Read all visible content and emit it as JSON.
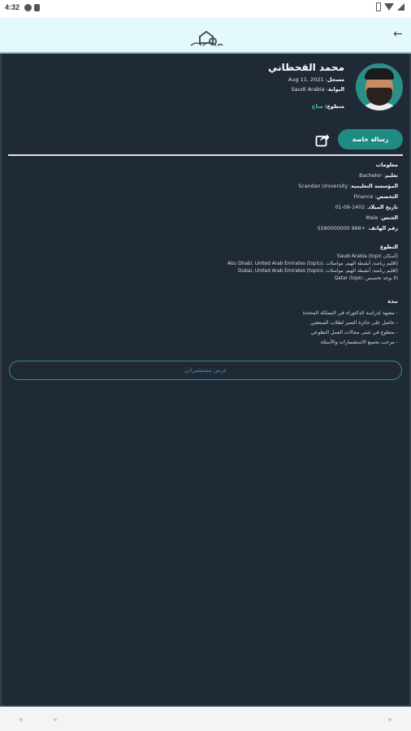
{
  "status_bar": {
    "time": "4:32"
  },
  "app_bar": {
    "back_icon": "arrow-left-icon",
    "logo_icon": "mosque-logo-icon"
  },
  "profile": {
    "name": "محمد القحطاني",
    "registered_label": "مسجل",
    "registered_date": "Aug 11, 2021",
    "country_label": "البوابة",
    "country": "Saudi Arabia",
    "status_label": "متطوع",
    "status": "متاح",
    "status_color": "#3fd69d"
  },
  "actions": {
    "message_button": "رسالة خاصة",
    "share_icon": "share-icon",
    "accent": "#208b84"
  },
  "info": {
    "section_title": "معلومات",
    "education_label": "تعليم",
    "education": "Bachelor",
    "institution_label": "المؤسسة التعليمية",
    "institution": "Scandan University",
    "specialty_label": "التخصص",
    "specialty": "Finance",
    "birth_label": "تاريخ الميلاد",
    "birth": "1402-09-01",
    "gender_label": "الجنس",
    "gender": "Male",
    "phone_label": "رقم الهاتف",
    "phone": "+966 5580000000"
  },
  "tours": {
    "section_title": "التطوع",
    "rows": [
      "(أسكان Saudi Arabia (topic",
      "(اقليم رياضة, أنشطة الهيم, مواصلات :Abu Dhabi, United Arab Emirates (topics",
      "(اقليم رياضة, أنشطة الهيم, مواصلات :Dubai, United Arab Emirates (topics",
      "(لا يوجد تخصيص :Qatar (topic"
    ]
  },
  "about": {
    "section_title": "نبذة",
    "rows": [
      "- مشهد لدراسة الدكتوراه في المملكة المتحدة",
      "- حاصل على جائزة التميز لطلاب المبتعثين",
      "- متطوع في شتى مجالات العمل التطوعي",
      "- مرحب بجميع الاستفسارات والأسئلة"
    ]
  },
  "consult_button": "عرض مستشيراتي"
}
